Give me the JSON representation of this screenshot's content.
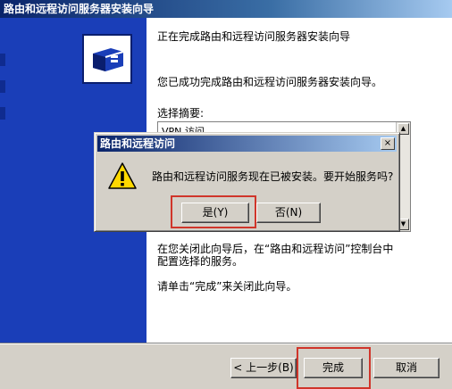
{
  "wizard": {
    "title": "路由和远程访问服务器安装向导",
    "heading": "正在完成路由和远程访问服务器安装向导",
    "success_text": "您已成功完成路由和远程访问服务器安装向导。",
    "summary_label": "选择摘要:",
    "summary_first_line": "VPN 访问",
    "after_close_line1": "在您关闭此向导后，在“路由和远程访问”控制台中",
    "after_close_line2": "配置选择的服务。",
    "click_finish_text": "请单击“完成”来关闭此向导。",
    "buttons": {
      "back": "< 上一步(B)",
      "finish": "完成",
      "cancel": "取消"
    }
  },
  "dialog": {
    "title": "路由和远程访问",
    "message": "路由和远程访问服务现在已被安装。要开始服务吗?",
    "close_glyph": "×",
    "yes_label": "是(Y)",
    "no_label": "否(N)",
    "icon": "warning-icon"
  },
  "highlight_color": "#d0352a"
}
